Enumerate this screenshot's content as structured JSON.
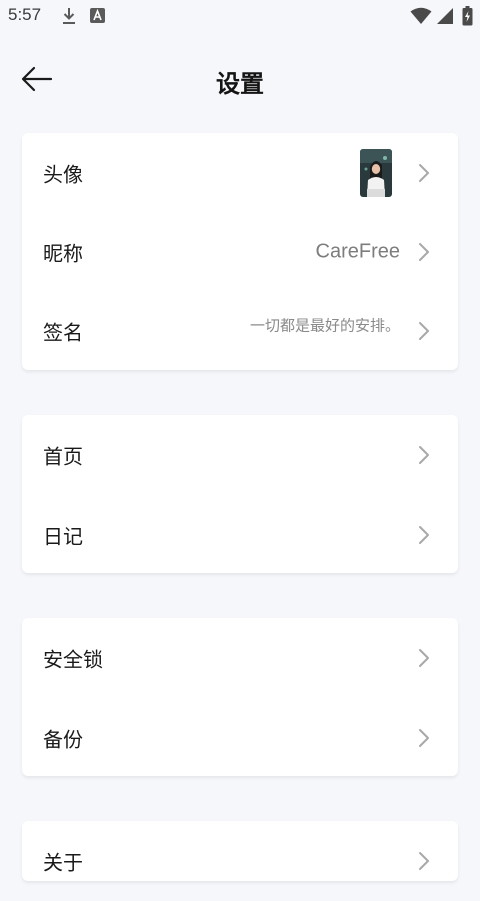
{
  "status_bar": {
    "time": "5:57",
    "icons": [
      "download-icon",
      "a-notification-icon",
      "wifi-icon",
      "signal-icon",
      "battery-icon"
    ]
  },
  "header": {
    "title": "设置",
    "back_icon": "arrow-left-icon"
  },
  "groups": [
    {
      "items": [
        {
          "label": "头像",
          "value_type": "avatar"
        },
        {
          "label": "昵称",
          "value": "CareFree"
        },
        {
          "label": "签名",
          "value": "一切都是最好的安排。"
        }
      ]
    },
    {
      "items": [
        {
          "label": "首页"
        },
        {
          "label": "日记"
        }
      ]
    },
    {
      "items": [
        {
          "label": "安全锁"
        },
        {
          "label": "备份"
        }
      ]
    },
    {
      "items": [
        {
          "label": "关于"
        }
      ]
    }
  ],
  "colors": {
    "background": "#f6f7fb",
    "card": "#ffffff",
    "chevron": "#a8a8a8",
    "value_text": "#7d7d7d"
  }
}
